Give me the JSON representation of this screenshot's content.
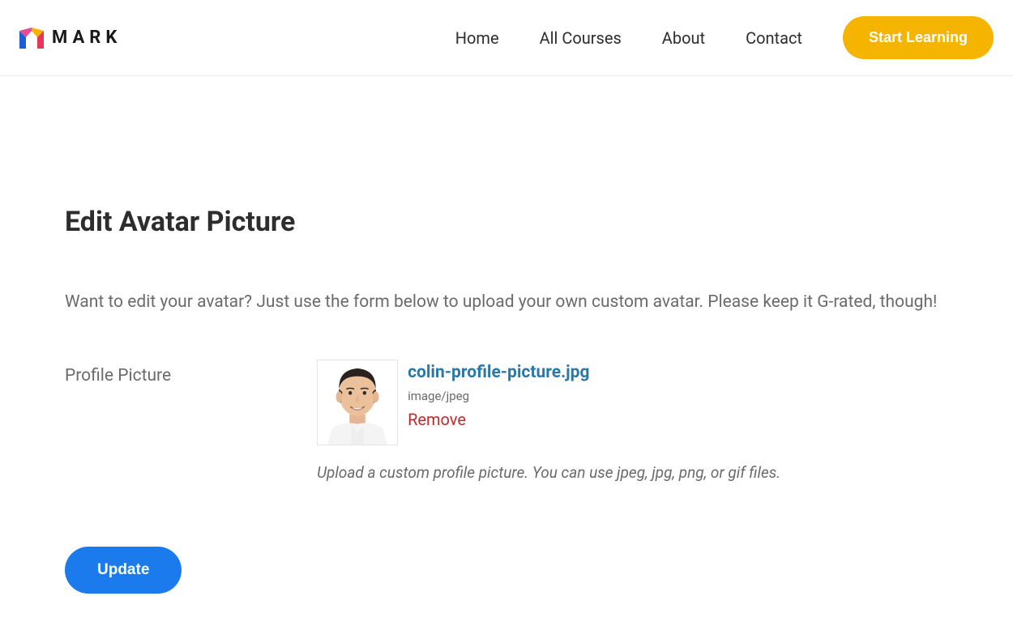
{
  "header": {
    "logo_text": "MARK",
    "nav": [
      {
        "label": "Home"
      },
      {
        "label": "All Courses"
      },
      {
        "label": "About"
      },
      {
        "label": "Contact"
      }
    ],
    "cta_label": "Start Learning"
  },
  "main": {
    "title": "Edit Avatar Picture",
    "description": "Want to edit your avatar? Just use the form below to upload your own custom avatar. Please keep it G-rated, though!",
    "form": {
      "label": "Profile Picture",
      "file": {
        "name": "colin-profile-picture.jpg",
        "mime": "image/jpeg"
      },
      "remove_label": "Remove",
      "hint": "Upload a custom profile picture. You can use jpeg, jpg, png, or gif files.",
      "submit_label": "Update"
    }
  }
}
